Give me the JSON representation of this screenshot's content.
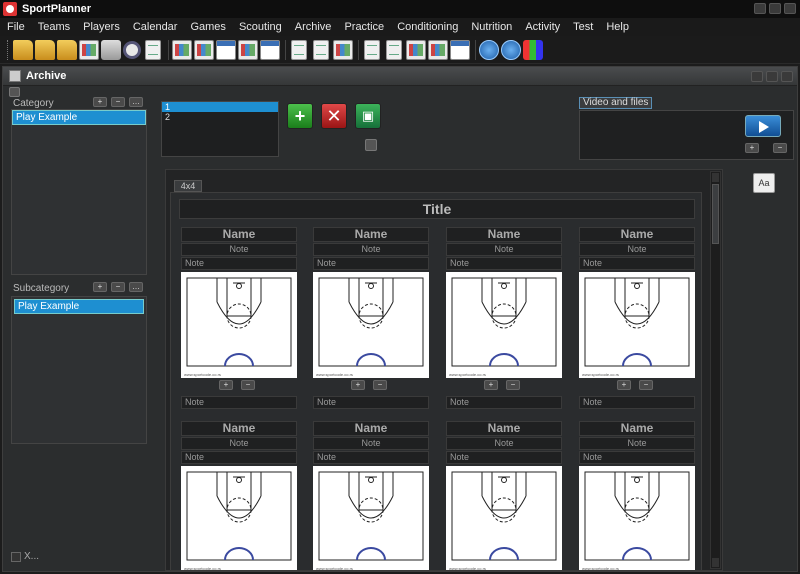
{
  "app": {
    "title": "SportPlanner"
  },
  "menu": [
    "File",
    "Teams",
    "Players",
    "Calendar",
    "Games",
    "Scouting",
    "Archive",
    "Practice",
    "Conditioning",
    "Nutrition",
    "Activity",
    "Test",
    "Help"
  ],
  "toolbar": {
    "icons": [
      "new-folder-icon",
      "open-folder-icon",
      "folder-icon",
      "board-icon",
      "print-icon",
      "preview-icon",
      "document-icon",
      "team-icon",
      "player-icon",
      "calendar-icon",
      "game-icon",
      "scouting-icon",
      "archive-icon",
      "practice-icon",
      "exercise-icon",
      "drill-icon",
      "nutrition-icon",
      "activity-icon",
      "test-icon",
      "help-icon",
      "info-icon",
      "colors-icon"
    ]
  },
  "archive": {
    "title": "Archive",
    "category": {
      "label": "Category",
      "items": [
        "Play Example"
      ]
    },
    "subcategory": {
      "label": "Subcategory",
      "items": [
        "Play Example"
      ]
    },
    "checkbox_label": "X...",
    "list": [
      "1",
      "2"
    ],
    "video": {
      "label": "Video and files"
    },
    "format_button": "Aa",
    "sheet": {
      "tab": "4x4",
      "title": "Title",
      "cell": {
        "name": "Name",
        "note": "Note",
        "note_label": "Note",
        "caption": "www.sportcode.co.rs"
      }
    }
  }
}
